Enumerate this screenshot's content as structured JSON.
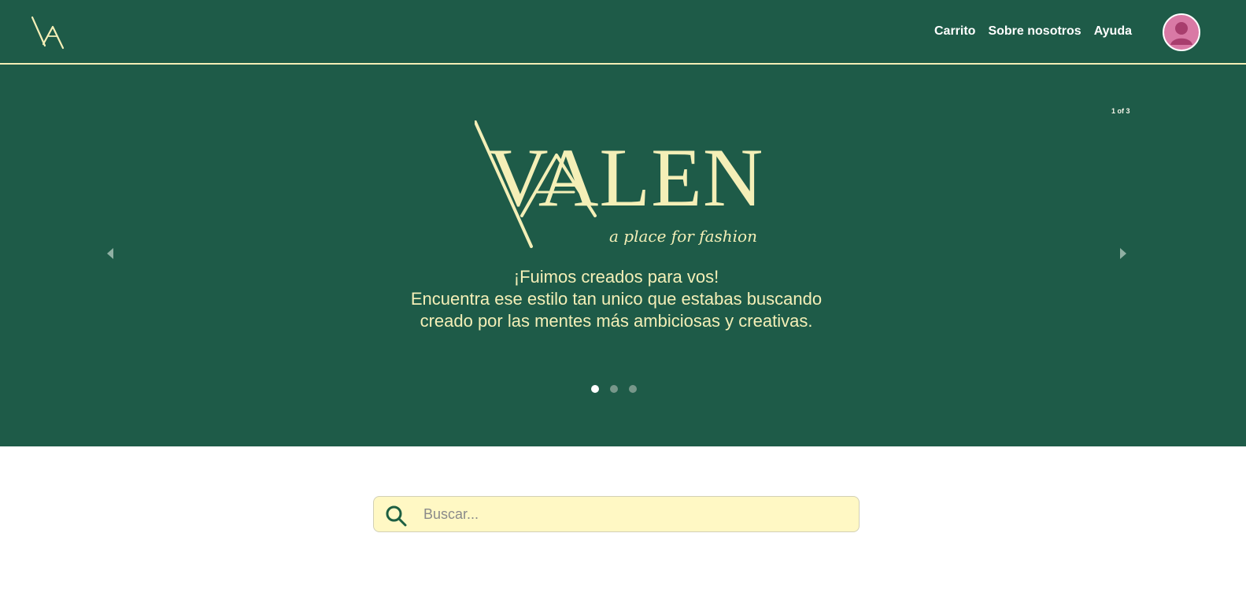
{
  "header": {
    "logo_text": "VA",
    "nav": [
      {
        "label": "Carrito"
      },
      {
        "label": "Sobre nosotros"
      },
      {
        "label": "Ayuda"
      }
    ],
    "profile_icon": "user-avatar-icon"
  },
  "carousel": {
    "counter": "1 of 3",
    "brand_name": "VALEN",
    "brand_tagline": "a place for fashion",
    "message": [
      "¡Fuimos creados para vos!",
      "Encuentra ese estilo tan unico que estabas buscando",
      "creado por las mentes más ambiciosas y creativas."
    ],
    "current_slide": 1,
    "total_slides": 3,
    "controls": {
      "previous_icon": "chevron-left-icon",
      "next_icon": "chevron-right-icon"
    }
  },
  "search": {
    "placeholder": "Buscar...",
    "icon": "search-icon"
  },
  "colors": {
    "primary_green": "#1e5b48",
    "cream": "#f4efb7",
    "search_background": "#fff8c4",
    "avatar_pink": "#d979a5"
  }
}
